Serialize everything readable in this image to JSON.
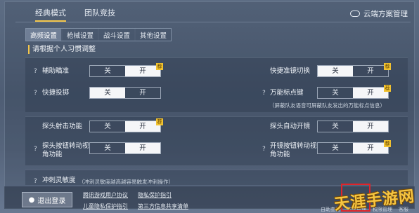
{
  "top_tabs": [
    {
      "label": "经典模式",
      "active": true
    },
    {
      "label": "团队竞技",
      "active": false
    }
  ],
  "cloud_sync": {
    "label": "云端方案管理",
    "icon": "cloud-icon"
  },
  "sub_tabs": [
    {
      "label": "高频设置",
      "active": true
    },
    {
      "label": "枪械设置",
      "active": false
    },
    {
      "label": "战斗设置",
      "active": false
    },
    {
      "label": "其他设置",
      "active": false
    }
  ],
  "section_title": "请根据个人习惯调整",
  "toggle_labels": {
    "off": "关",
    "on": "开"
  },
  "settings": {
    "aim_assist": {
      "label": "辅助瞄准",
      "value": "开",
      "tag": "荐"
    },
    "quick_scope": {
      "label": "快捷准镜切换",
      "value": "关",
      "tag": "荐"
    },
    "quick_throw": {
      "label": "快捷投掷",
      "value": "关"
    },
    "universal_mark": {
      "label": "万能标点键",
      "value": "开",
      "tag": "荐",
      "note": "（屏蔽队友语音可屏蔽队友发出的万能标点信息）"
    },
    "peek_fire": {
      "label": "探头射击功能",
      "value": "开",
      "tag": "荐"
    },
    "peek_auto_scope": {
      "label": "探头自动开镜",
      "value": "开"
    },
    "peek_rotate": {
      "label": "探头按钮转动视角功能",
      "value": "开"
    },
    "scope_rotate": {
      "label": "开镜按钮转动视角功能",
      "value": "开",
      "tag": "荐"
    }
  },
  "sprint": {
    "label": "冲刺灵敏度",
    "note": "（冲刺灵敏度越高越容易触发冲刺操作）"
  },
  "bottom": {
    "logout_label": "退出登录",
    "links": [
      "腾讯游戏用户协议",
      "隐私保护指引",
      "儿童隐私保护指引",
      "第三方信息共享清单"
    ],
    "items": [
      "自助查询",
      "信息管理",
      "权限管理",
      "客服"
    ]
  },
  "watermark": "天涯手游网",
  "colors": {
    "accent": "#f3c64a",
    "toggle_on": "#f5f6f8",
    "tag": "#f1c230",
    "highlight": "#e0242a"
  }
}
